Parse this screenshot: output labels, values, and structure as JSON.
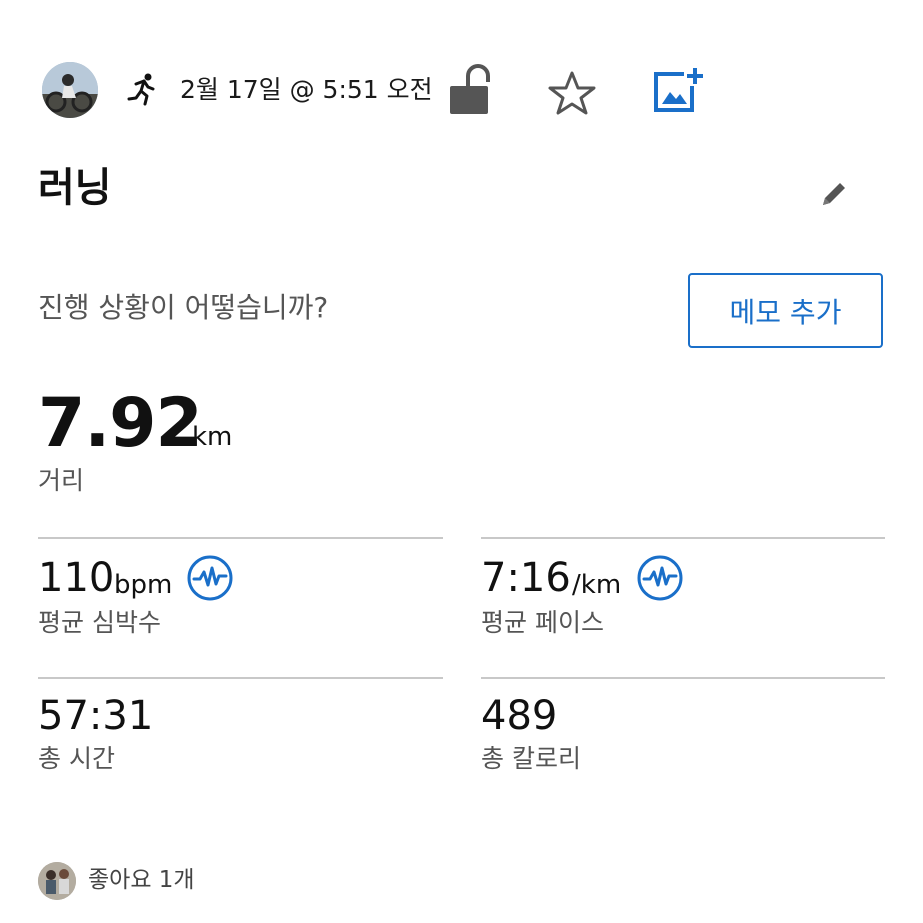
{
  "header": {
    "date": "2월 17일 @ 5:51 오전",
    "icons": {
      "activity": "running-person-icon",
      "privacy": "unlocked-padlock-icon",
      "favorite": "star-outline-icon",
      "media": "add-photo-icon"
    }
  },
  "activity": {
    "title": "러닝",
    "prompt": "진행 상황이 어떻습니까?",
    "memo_button": "메모 추가"
  },
  "primary_stat": {
    "value": "7.92",
    "unit": "km",
    "label": "거리"
  },
  "stats": [
    {
      "value": "110",
      "unit": "bpm",
      "label": "평균 심박수",
      "icon": "heart-rate-wave-icon"
    },
    {
      "value": "7:16",
      "unit": "/km",
      "label": "평균 페이스",
      "icon": "heart-rate-wave-icon"
    },
    {
      "value": "57:31",
      "unit": "",
      "label": "총 시간"
    },
    {
      "value": "489",
      "unit": "",
      "label": "총 칼로리"
    }
  ],
  "social": {
    "likes_text": "좋아요 1개"
  },
  "colors": {
    "accent": "#1a6fc9",
    "text_primary": "#111111",
    "text_secondary": "#555555",
    "divider": "#c8c8c8",
    "icon_gray": "#555555"
  }
}
